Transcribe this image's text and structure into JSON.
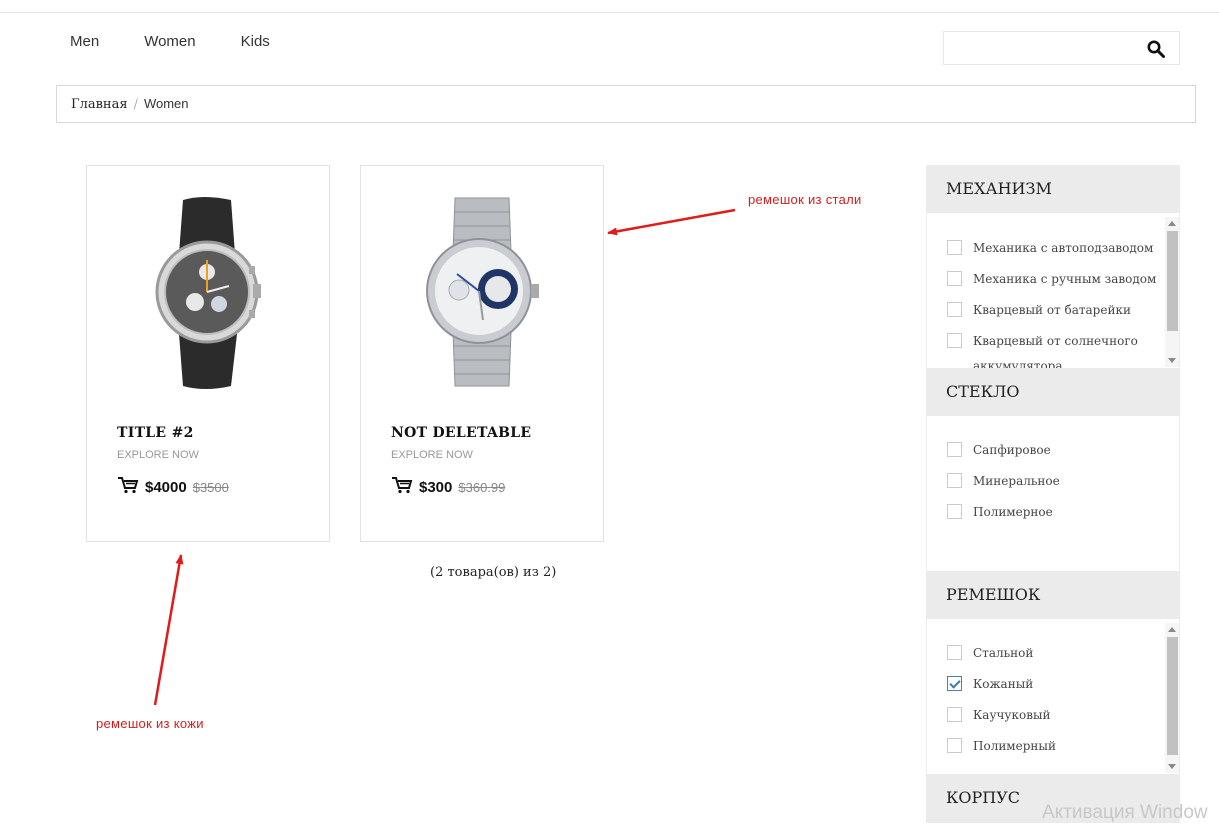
{
  "nav": {
    "items": [
      "Men",
      "Women",
      "Kids"
    ]
  },
  "search": {
    "placeholder": "",
    "icon": "search-icon"
  },
  "breadcrumb": {
    "home": "Главная",
    "separator": "/",
    "current": "Women"
  },
  "products": [
    {
      "title": "TITLE #2",
      "explore": "EXPLORE NOW",
      "price": "$4000",
      "old_price": "$3500",
      "cart_icon": "cart-icon",
      "image": "leather-strap-watch"
    },
    {
      "title": "NOT DELETABLE",
      "explore": "EXPLORE NOW",
      "price": "$300",
      "old_price": "$360.99",
      "cart_icon": "cart-icon",
      "image": "steel-bracelet-watch"
    }
  ],
  "count_text": "(2 товара(ов) из 2)",
  "annotations": {
    "steel": "ремешок из стали",
    "leather": "ремешок из кожи",
    "color": "#d61d1d"
  },
  "filters": {
    "mechanism": {
      "title": "МЕХАНИЗМ",
      "options": [
        {
          "label": "Механика с автоподзаводом",
          "checked": false
        },
        {
          "label": "Механика с ручным заводом",
          "checked": false
        },
        {
          "label": "Кварцевый от батарейки",
          "checked": false
        },
        {
          "label": "Кварцевый от солнечного",
          "checked": false
        },
        {
          "label": "аккумулятора",
          "checked": false
        }
      ]
    },
    "glass": {
      "title": "СТЕКЛО",
      "options": [
        {
          "label": "Сапфировое",
          "checked": false
        },
        {
          "label": "Минеральное",
          "checked": false
        },
        {
          "label": "Полимерное",
          "checked": false
        }
      ]
    },
    "strap": {
      "title": "РЕМЕШОК",
      "options": [
        {
          "label": "Стальной",
          "checked": false
        },
        {
          "label": "Кожаный",
          "checked": true
        },
        {
          "label": "Каучуковый",
          "checked": false
        },
        {
          "label": "Полимерный",
          "checked": false
        }
      ]
    },
    "case": {
      "title": "КОРПУС"
    }
  },
  "watermark": "Активация Window"
}
